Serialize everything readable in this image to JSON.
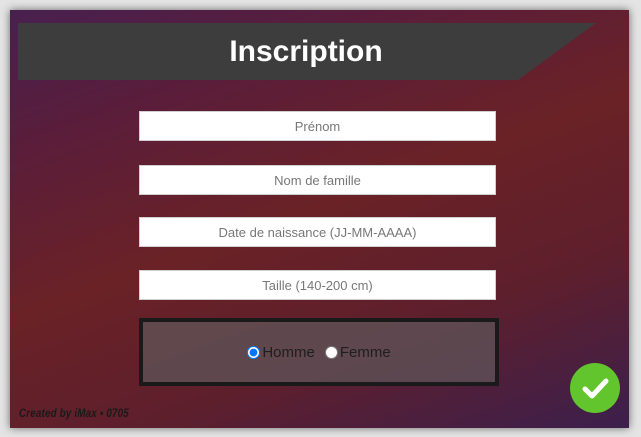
{
  "header": {
    "title": "Inscription"
  },
  "form": {
    "first_name": {
      "placeholder": "Prénom",
      "value": ""
    },
    "last_name": {
      "placeholder": "Nom de famille",
      "value": ""
    },
    "birth_date": {
      "placeholder": "Date de naissance (JJ-MM-AAAA)",
      "value": ""
    },
    "height": {
      "placeholder": "Taille (140-200 cm)",
      "value": ""
    },
    "gender": {
      "options": [
        "Homme",
        "Femme"
      ],
      "selected": "Homme"
    }
  },
  "footer": {
    "credit": "Created by iMax • 0705"
  },
  "submit": {
    "icon": "checkmark-icon",
    "color": "#62c52d"
  }
}
